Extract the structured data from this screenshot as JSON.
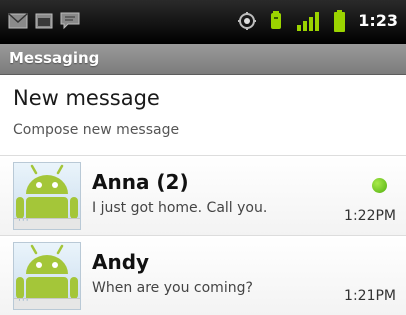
{
  "status_bar": {
    "time": "1:23",
    "icons": [
      "gmail-icon",
      "calendar-icon",
      "talk-icon",
      "gps-icon",
      "usb-debug-icon",
      "signal-icon",
      "battery-icon"
    ]
  },
  "app": {
    "title": "Messaging"
  },
  "new_message": {
    "title": "New message",
    "subtitle": "Compose new message"
  },
  "conversations": [
    {
      "name": "Anna (2)",
      "snippet": "I just got home. Call you.",
      "time": "1:22PM",
      "online": true,
      "presence_color": "#6cc624"
    },
    {
      "name": "Andy",
      "snippet": "When are you coming?",
      "time": "1:21PM",
      "online": false
    }
  ],
  "colors": {
    "android_green": "#a4c639",
    "status_icon_green": "#9bd400",
    "title_bar": "#8c8c8c"
  }
}
